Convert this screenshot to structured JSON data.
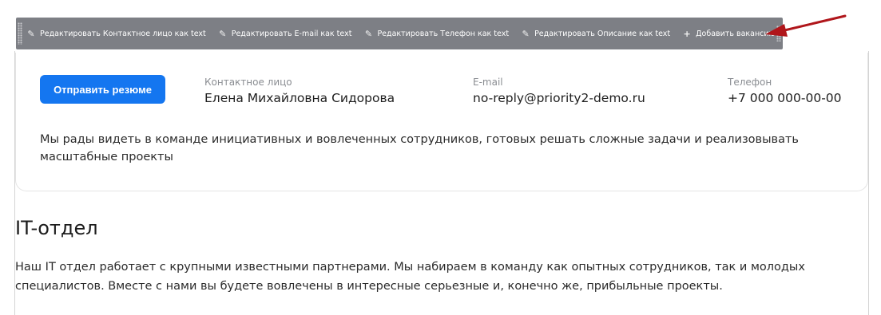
{
  "toolbar": {
    "items": [
      {
        "label": "Редактировать Контактное лицо как text",
        "icon": "pencil-icon"
      },
      {
        "label": "Редактировать E-mail как text",
        "icon": "pencil-icon"
      },
      {
        "label": "Редактировать Телефон как text",
        "icon": "pencil-icon"
      },
      {
        "label": "Редактировать Описание как text",
        "icon": "pencil-icon"
      },
      {
        "label": "Добавить вакансию",
        "icon": "plus-icon"
      }
    ],
    "pin_icon": "pin-icon",
    "settings_icon": "gear-icon",
    "background": "#7d7f85"
  },
  "card": {
    "button_label": "Отправить резюме",
    "button_color": "#1476f0",
    "contact": {
      "label": "Контактное лицо",
      "value": "Елена Михайловна Сидорова"
    },
    "email": {
      "label": "E-mail",
      "value": "no-reply@priority2-demo.ru"
    },
    "phone": {
      "label": "Телефон",
      "value": "+7 000 000-00-00"
    },
    "description": "Мы рады видеть в команде инициативных и вовлеченных сотрудников, готовых решать сложные задачи и реализовывать масштабные проекты"
  },
  "section": {
    "title": "IT-отдел",
    "text": "Наш IT отдел работает с крупными известными партнерами. Мы набираем в команду как опытных сотрудников, так и молодых специалистов. Вместе с нами вы будете вовлечены в интересные серьезные и, конечно же, прибыльные проекты."
  },
  "annotation": {
    "arrow_color": "#b0161b"
  }
}
